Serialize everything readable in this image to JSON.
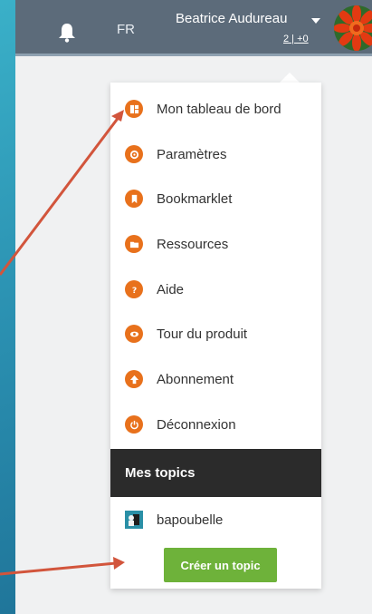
{
  "colors": {
    "topbar": "#5c6b7a",
    "accent_orange": "#e8711c",
    "section_header": "#2b2b2b",
    "create_button": "#6eb23a",
    "annotation_arrow": "#d2553c"
  },
  "header": {
    "notifications_icon": "bell-icon",
    "language": "FR",
    "user_name": "Beatrice Audureau",
    "counts": "2 | +0",
    "avatar_icon": "flower-avatar"
  },
  "menu": {
    "items": [
      {
        "label": "Mon tableau de bord",
        "icon": "dashboard-icon"
      },
      {
        "label": "Paramètres",
        "icon": "gear-icon"
      },
      {
        "label": "Bookmarklet",
        "icon": "bookmark-icon"
      },
      {
        "label": "Ressources",
        "icon": "folder-icon"
      },
      {
        "label": "Aide",
        "icon": "help-icon"
      },
      {
        "label": "Tour du produit",
        "icon": "eye-icon"
      },
      {
        "label": "Abonnement",
        "icon": "upload-icon"
      },
      {
        "label": "Déconnexion",
        "icon": "power-icon"
      }
    ],
    "section_title": "Mes topics",
    "topics": [
      {
        "label": "bapoubelle",
        "icon": "topic-thumbnail"
      }
    ],
    "create_label": "Créer un topic"
  }
}
